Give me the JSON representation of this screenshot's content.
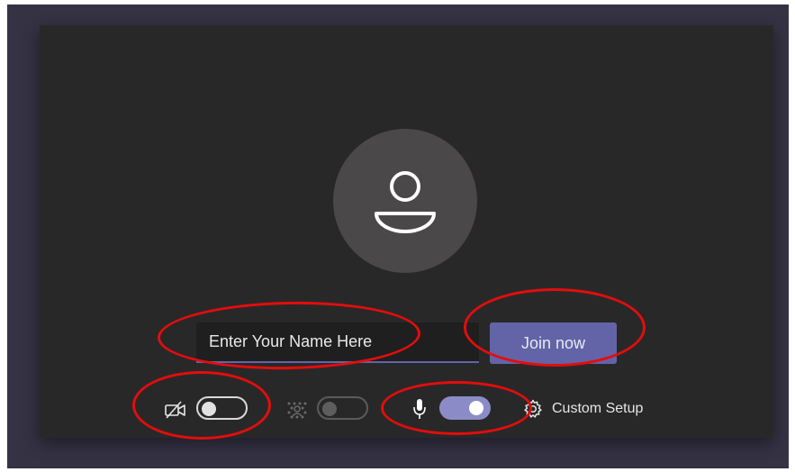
{
  "join": {
    "name_placeholder": "Enter Your Name Here",
    "join_button_label": "Join now"
  },
  "controls": {
    "video": {
      "icon": "camera-off-icon",
      "state": "off"
    },
    "background_effects": {
      "icon": "background-blur-icon",
      "state": "off",
      "disabled": true
    },
    "microphone": {
      "icon": "microphone-icon",
      "state": "on"
    },
    "custom_setup": {
      "icon": "gear-icon",
      "label": "Custom Setup"
    }
  },
  "colors": {
    "accent": "#6264a7",
    "panel": "#292828",
    "frame": "#353244",
    "annotation": "#e30d0d"
  }
}
